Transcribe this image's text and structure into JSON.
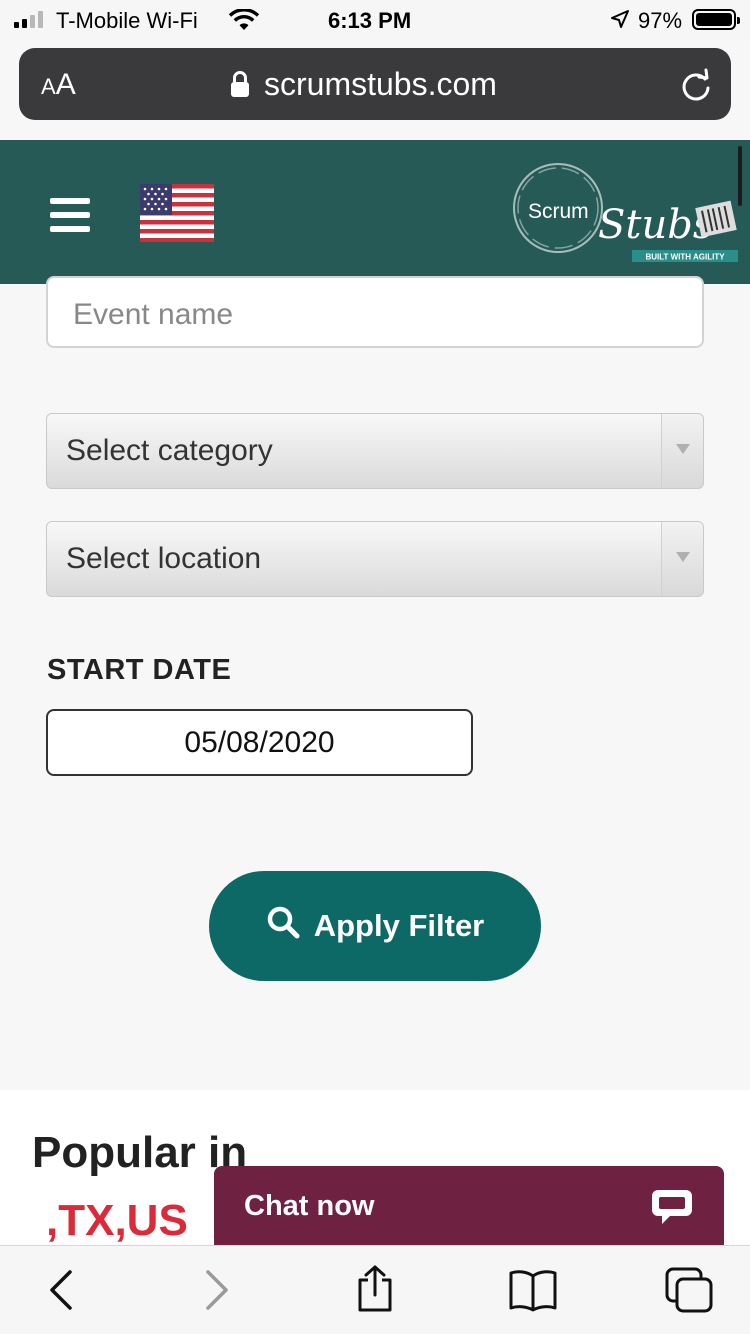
{
  "status_bar": {
    "carrier": "T-Mobile Wi-Fi",
    "time": "6:13 PM",
    "battery": "97%"
  },
  "browser": {
    "text_size_label_small": "A",
    "text_size_label_large": "A",
    "domain": "scrumstubs.com"
  },
  "header": {
    "logo_text": "Scrum",
    "logo_script": "Stubs",
    "logo_tagline": "BUILT WITH AGILITY"
  },
  "form": {
    "event_name_placeholder": "Event name",
    "category_label": "Select category",
    "location_label": "Select location",
    "start_date_label": "START DATE",
    "start_date_value": "05/08/2020",
    "apply_label": "Apply Filter"
  },
  "popular": {
    "title": "Popular in",
    "location": ",TX,US"
  },
  "chat": {
    "label": "Chat now"
  },
  "colors": {
    "header_bg": "#265a57",
    "button_bg": "#0d6966",
    "chat_bg": "#6f2142",
    "location_red": "#d92b3a"
  },
  "icons": [
    "signal-icon",
    "wifi-icon",
    "location-arrow-icon",
    "battery-icon",
    "lock-icon",
    "reload-icon",
    "hamburger-icon",
    "us-flag-icon",
    "search-icon",
    "chat-bubble-icon",
    "back-icon",
    "forward-icon",
    "share-icon",
    "bookmarks-icon",
    "tabs-icon"
  ]
}
